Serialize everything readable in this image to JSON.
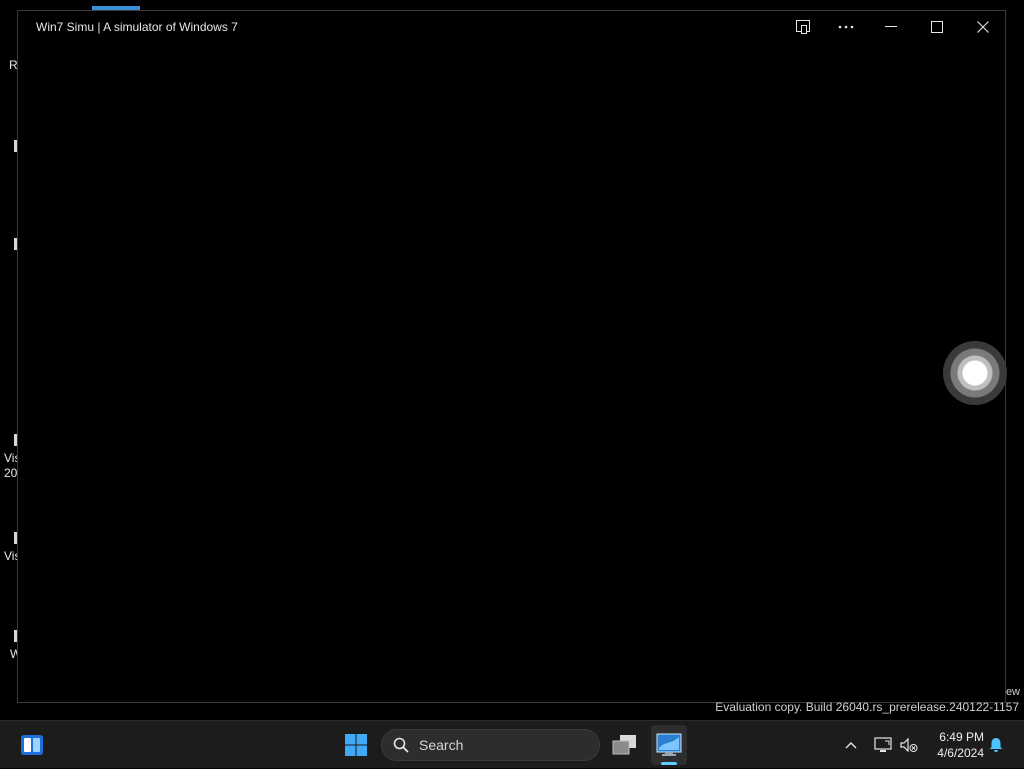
{
  "window": {
    "title": "Win7 Simu | A simulator of Windows 7",
    "buttons": {
      "compact_overlay": "compact-overlay-icon",
      "more": "more-icon",
      "minimize": "minimize-icon",
      "maximize": "maximize-icon",
      "close": "close-icon"
    },
    "loading_indicator": "loading-spinner-icon"
  },
  "desktop": {
    "icons": [
      {
        "label": "Re"
      },
      {
        "label": ""
      },
      {
        "label": ""
      },
      {
        "label": "Vis"
      },
      {
        "label": "20"
      },
      {
        "label": "Vis"
      },
      {
        "label": "W"
      }
    ]
  },
  "watermark": {
    "edge_text": "ew",
    "text": "Evaluation copy. Build 26040.rs_prerelease.240122-1157"
  },
  "taskbar": {
    "widgets_icon": "widgets-icon",
    "start_icon": "windows-start-icon",
    "search_placeholder": "Search",
    "task_view_icon": "task-view-icon",
    "active_app_icon": "win7-simu-app-icon",
    "tray": {
      "overflow_icon": "chevron-up-icon",
      "network_icon": "network-icon",
      "volume_icon": "volume-muted-icon",
      "time": "6:49 PM",
      "date": "4/6/2024",
      "notification_icon": "notification-bell-icon"
    },
    "accent_color": "#60cdff"
  }
}
